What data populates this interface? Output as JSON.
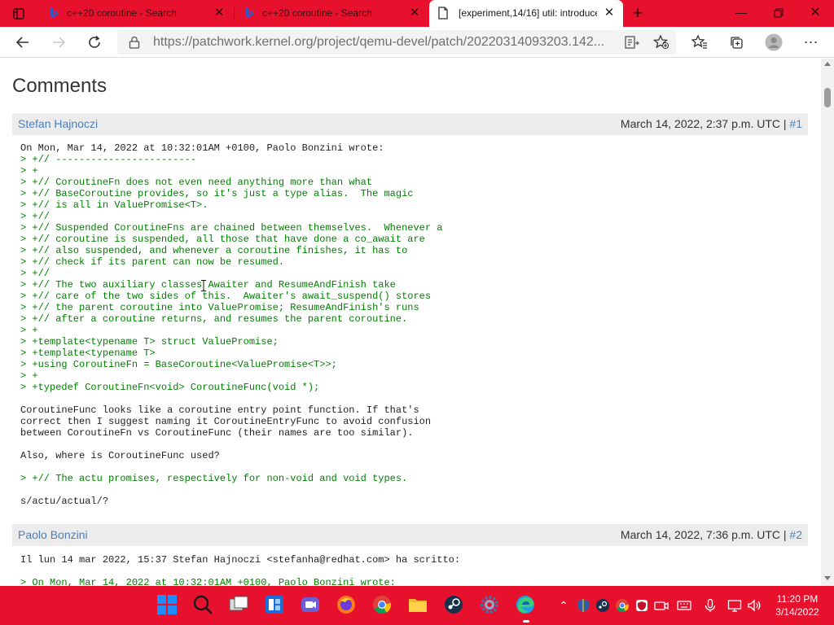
{
  "browser": {
    "tabs": [
      {
        "title": "c++20 coroutine - Search",
        "active": false
      },
      {
        "title": "c++20 coroutine - Search",
        "active": false
      },
      {
        "title": "[experiment,14/16] util: introduce",
        "active": true
      }
    ],
    "address": {
      "url": "https://patchwork.kernel.org/project/qemu-devel/patch/20220314093203.142..."
    }
  },
  "page": {
    "heading": "Comments",
    "comments": [
      {
        "author": "Stefan Hajnoczi",
        "date": "March 14, 2022, 2:37 p.m. UTC",
        "separator": "|",
        "number": "#1",
        "lines": [
          {
            "text": "On Mon, Mar 14, 2022 at 10:32:01AM +0100, Paolo Bonzini wrote:",
            "quote": false
          },
          {
            "text": "> +// ------------------------",
            "quote": true
          },
          {
            "text": "> +",
            "quote": true
          },
          {
            "text": "> +// CoroutineFn does not even need anything more than what",
            "quote": true
          },
          {
            "text": "> +// BaseCoroutine provides, so it's just a type alias.  The magic",
            "quote": true
          },
          {
            "text": "> +// is all in ValuePromise<T>.",
            "quote": true
          },
          {
            "text": "> +//",
            "quote": true
          },
          {
            "text": "> +// Suspended CoroutineFns are chained between themselves.  Whenever a",
            "quote": true
          },
          {
            "text": "> +// coroutine is suspended, all those that have done a co_await are",
            "quote": true
          },
          {
            "text": "> +// also suspended, and whenever a coroutine finishes, it has to",
            "quote": true
          },
          {
            "text": "> +// check if its parent can now be resumed.",
            "quote": true
          },
          {
            "text": "> +//",
            "quote": true
          },
          {
            "text": "> +// The two auxiliary classes Awaiter and ResumeAndFinish take",
            "quote": true
          },
          {
            "text": "> +// care of the two sides of this.  Awaiter's await_suspend() stores",
            "quote": true
          },
          {
            "text": "> +// the parent coroutine into ValuePromise; ResumeAndFinish's runs",
            "quote": true
          },
          {
            "text": "> +// after a coroutine returns, and resumes the parent coroutine.",
            "quote": true
          },
          {
            "text": "> +",
            "quote": true
          },
          {
            "text": "> +template<typename T> struct ValuePromise;",
            "quote": true
          },
          {
            "text": "> +template<typename T>",
            "quote": true
          },
          {
            "text": "> +using CoroutineFn = BaseCoroutine<ValuePromise<T>>;",
            "quote": true
          },
          {
            "text": "> +",
            "quote": true
          },
          {
            "text": "> +typedef CoroutineFn<void> CoroutineFunc(void *);",
            "quote": true
          },
          {
            "text": "",
            "quote": false
          },
          {
            "text": "CoroutineFunc looks like a coroutine entry point function. If that's",
            "quote": false
          },
          {
            "text": "correct then I suggest naming it CoroutineEntryFunc to avoid confusion",
            "quote": false
          },
          {
            "text": "between CoroutineFn vs CoroutineFunc (their names are too similar).",
            "quote": false
          },
          {
            "text": "",
            "quote": false
          },
          {
            "text": "Also, where is CoroutineFunc used?",
            "quote": false
          },
          {
            "text": "",
            "quote": false
          },
          {
            "text": "> +// The actu promises, respectively for non-void and void types.",
            "quote": true
          },
          {
            "text": "",
            "quote": false
          },
          {
            "text": "s/actu/actual/?",
            "quote": false
          }
        ]
      },
      {
        "author": "Paolo Bonzini",
        "date": "March 14, 2022, 7:36 p.m. UTC",
        "separator": "|",
        "number": "#2",
        "lines": [
          {
            "text": "Il lun 14 mar 2022, 15:37 Stefan Hajnoczi <stefanha@redhat.com> ha scritto:",
            "quote": false
          },
          {
            "text": "",
            "quote": false
          },
          {
            "text": "> On Mon, Mar 14, 2022 at 10:32:01AM +0100, Paolo Bonzini wrote:",
            "quote": true
          }
        ]
      }
    ]
  },
  "taskbar": {
    "clock": {
      "time": "11:20 PM",
      "date": "3/14/2022"
    }
  },
  "colors": {
    "chrome_red": "#e8112d",
    "link_blue": "#4a7fb8",
    "quote_green": "#008000"
  },
  "icons": {
    "tabbar": [
      "tab-actions-icon",
      "bing-icon",
      "bing-icon",
      "page-icon",
      "new-tab-icon",
      "minimize-icon",
      "restore-icon",
      "close-window-icon"
    ],
    "toolbar": [
      "back-icon",
      "forward-icon",
      "refresh-icon",
      "lock-icon",
      "reader-mode-icon",
      "add-favorite-icon",
      "favorites-icon",
      "collections-icon",
      "profile-icon",
      "more-icon"
    ],
    "taskbar": [
      "windows-start-icon",
      "search-icon",
      "task-view-icon",
      "widgets-icon",
      "teams-chat-icon",
      "firefox-icon",
      "chrome-icon",
      "file-explorer-icon",
      "steam-icon",
      "settings-icon",
      "edge-icon"
    ]
  }
}
